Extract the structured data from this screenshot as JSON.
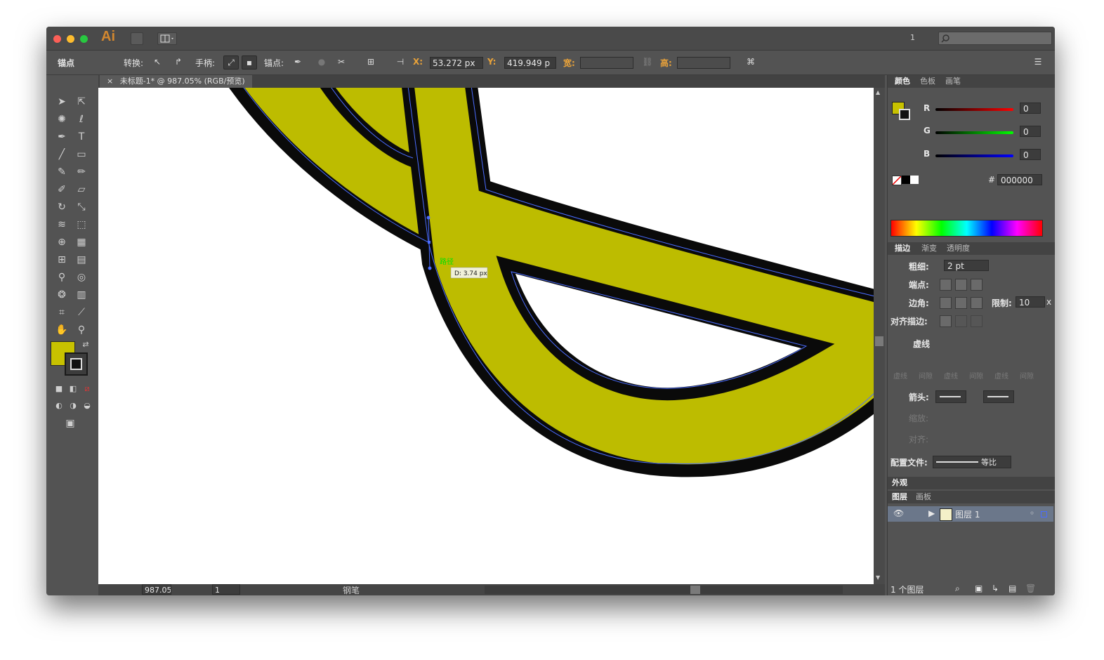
{
  "app": {
    "logo": "Ai",
    "title_page_num": "1"
  },
  "colors": {
    "accent_fill": "#c8c200",
    "selection_blue": "#4a6cff",
    "smart_guide": "#00e000"
  },
  "control_bar": {
    "section_label": "锚点",
    "convert_label": "转换:",
    "handles_label": "手柄:",
    "anchors_label": "锚点:",
    "x_label": "X:",
    "x_value": "53.272 px",
    "y_label": "Y:",
    "y_value": "419.949 p",
    "w_label": "宽:",
    "h_label": "高:"
  },
  "document": {
    "tab_title": "未标题-1* @ 987.05% (RGB/预览)",
    "close_icon": "×"
  },
  "canvas": {
    "smart_guide_label": "路径",
    "distance_tooltip": "D: 3.74 px"
  },
  "status": {
    "zoom": "987.05",
    "artboard": "1",
    "tool_name": "钢笔"
  },
  "color_panel": {
    "tabs": [
      "颜色",
      "色板",
      "画笔"
    ],
    "r_label": "R",
    "g_label": "G",
    "b_label": "B",
    "r": "0",
    "g": "0",
    "b": "0",
    "hex_label": "#",
    "hex": "000000"
  },
  "stroke_panel": {
    "tabs": [
      "描边",
      "渐变",
      "透明度"
    ],
    "weight_label": "粗细:",
    "weight_value": "2 pt",
    "cap_label": "端点:",
    "corner_label": "边角:",
    "limit_label": "限制:",
    "limit_value": "10",
    "limit_unit": "x",
    "align_label": "对齐描边:",
    "dashed_label": "虚线",
    "dash_labels": [
      "虚线",
      "间隙",
      "虚线",
      "间隙",
      "虚线",
      "间隙"
    ],
    "arrow_label": "箭头:",
    "scale_label": "缩放:",
    "align2_label": "对齐:",
    "profile_label": "配置文件:",
    "profile_value": "等比"
  },
  "appearance_panel": {
    "title": "外观"
  },
  "layers_panel": {
    "tabs": [
      "图层",
      "画板"
    ],
    "layer_name": "图层 1",
    "footer": "1 个图层"
  }
}
